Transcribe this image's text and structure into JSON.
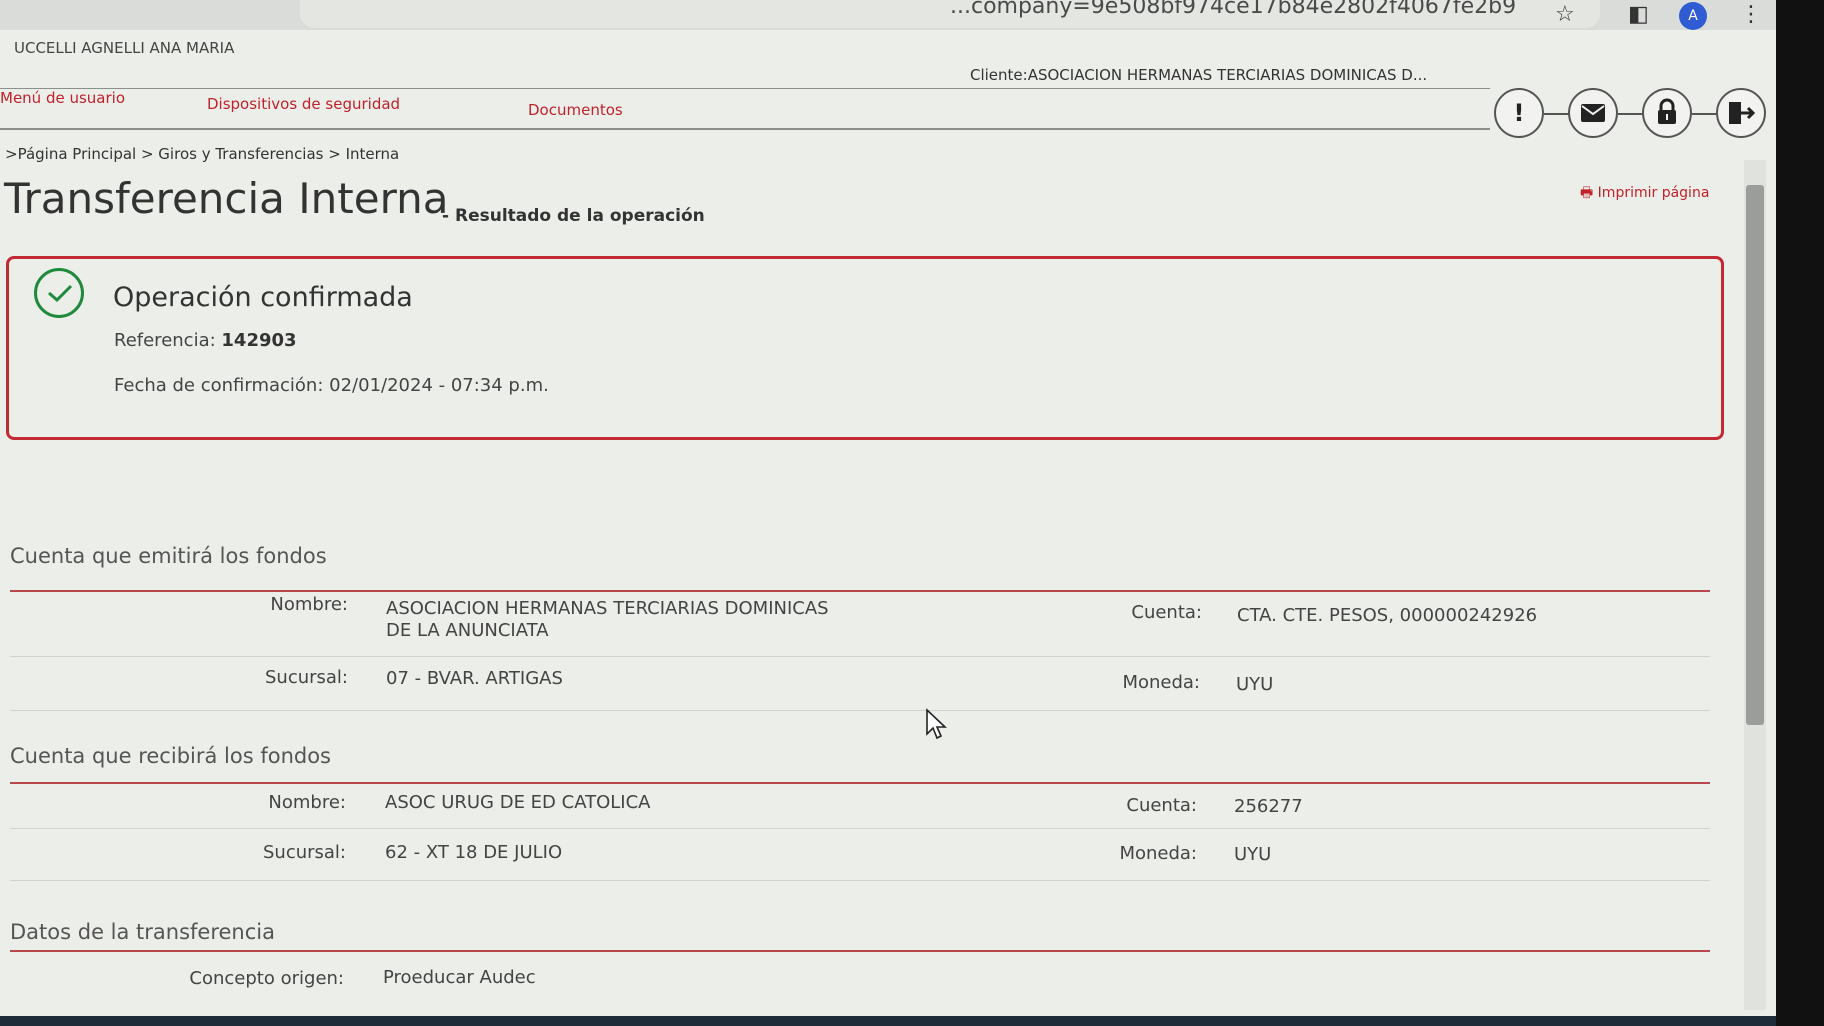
{
  "browser": {
    "url_fragment": "...company=9e508bf974ce17b84e2802f4067fe2b9",
    "avatar_letter": "A"
  },
  "header": {
    "user_name": "UCCELLI AGNELLI ANA MARIA",
    "client": "Cliente:ASOCIACION HERMANAS TERCIARIAS DOMINICAS D..."
  },
  "menu": {
    "user_menu": "Menú de usuario",
    "security_devices": "Dispositivos de seguridad",
    "documents": "Documentos"
  },
  "breadcrumb": ">Página Principal > Giros y Transferencias > Interna",
  "page": {
    "title": "Transferencia Interna",
    "subtitle": "- Resultado de la operación",
    "print": "Imprimir página"
  },
  "confirmation": {
    "title": "Operación confirmada",
    "reference_label": "Referencia:",
    "reference_value": "142903",
    "date_label": "Fecha de confirmación:",
    "date_value": "02/01/2024 - 07:34 p.m."
  },
  "source": {
    "heading": "Cuenta que emitirá los fondos",
    "name_label": "Nombre:",
    "name_line1": "ASOCIACION HERMANAS TERCIARIAS DOMINICAS",
    "name_line2": "DE LA ANUNCIATA",
    "account_label": "Cuenta:",
    "account_value": "CTA. CTE. PESOS, 000000242926",
    "branch_label": "Sucursal:",
    "branch_value": "07 - BVAR. ARTIGAS",
    "currency_label": "Moneda:",
    "currency_value": "UYU"
  },
  "destination": {
    "heading": "Cuenta que recibirá los fondos",
    "name_label": "Nombre:",
    "name_value": "ASOC URUG DE ED CATOLICA",
    "account_label": "Cuenta:",
    "account_value": "256277",
    "branch_label": "Sucursal:",
    "branch_value": "62 - XT 18 DE JULIO",
    "currency_label": "Moneda:",
    "currency_value": "UYU"
  },
  "transfer": {
    "heading": "Datos de la transferencia",
    "concept_label": "Concepto origen:",
    "concept_value": "Proeducar Audec"
  },
  "colors": {
    "accent_red": "#c0222b",
    "success_green": "#1f8a3b"
  }
}
